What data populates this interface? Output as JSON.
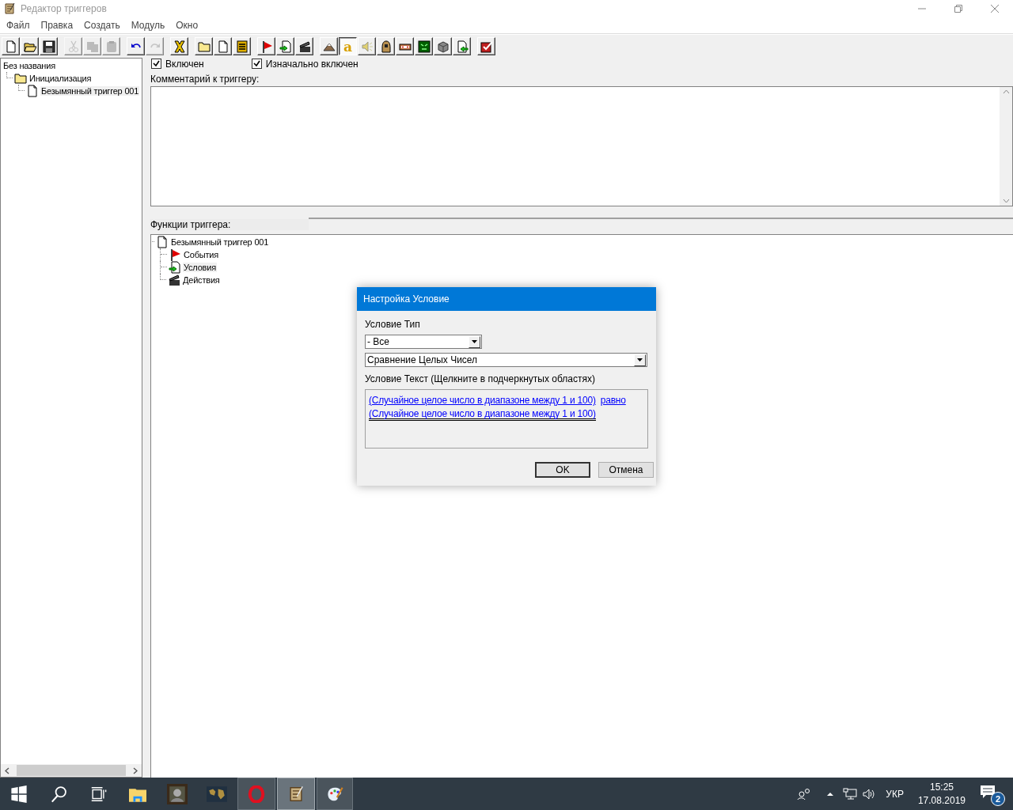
{
  "window": {
    "title": "Редактор триггеров"
  },
  "menu": [
    {
      "label": "Файл"
    },
    {
      "label": "Правка"
    },
    {
      "label": "Создать"
    },
    {
      "label": "Модуль"
    },
    {
      "label": "Окно"
    }
  ],
  "toolbar_groups": [
    {
      "buttons": [
        {
          "kind": "new",
          "disabled": false,
          "pressed": false
        },
        {
          "kind": "open",
          "disabled": false,
          "pressed": false
        },
        {
          "kind": "save",
          "disabled": false,
          "pressed": false
        }
      ]
    },
    {
      "buttons": [
        {
          "kind": "cut",
          "disabled": true,
          "pressed": false
        },
        {
          "kind": "copy",
          "disabled": true,
          "pressed": false
        },
        {
          "kind": "paste",
          "disabled": true,
          "pressed": false
        }
      ]
    },
    {
      "buttons": [
        {
          "kind": "undo",
          "disabled": false,
          "pressed": false
        },
        {
          "kind": "redo",
          "disabled": true,
          "pressed": false
        }
      ]
    },
    {
      "buttons": [
        {
          "kind": "delete",
          "disabled": false,
          "pressed": false
        }
      ]
    },
    {
      "buttons": [
        {
          "kind": "category",
          "disabled": false,
          "pressed": false
        },
        {
          "kind": "trigger",
          "disabled": false,
          "pressed": false
        },
        {
          "kind": "comment",
          "disabled": false,
          "pressed": false
        }
      ]
    },
    {
      "buttons": [
        {
          "kind": "event",
          "disabled": false,
          "pressed": false
        },
        {
          "kind": "condition",
          "disabled": false,
          "pressed": false
        },
        {
          "kind": "action",
          "disabled": false,
          "pressed": false
        }
      ]
    },
    {
      "buttons": [
        {
          "kind": "terrain",
          "disabled": false,
          "pressed": false
        },
        {
          "kind": "text",
          "glyph": "a",
          "disabled": false,
          "pressed": true
        },
        {
          "kind": "sound",
          "disabled": false,
          "pressed": false
        },
        {
          "kind": "unit",
          "disabled": false,
          "pressed": false
        },
        {
          "kind": "item",
          "disabled": false,
          "pressed": false
        },
        {
          "kind": "model",
          "disabled": false,
          "pressed": false
        },
        {
          "kind": "cube",
          "disabled": false,
          "pressed": false
        },
        {
          "kind": "import",
          "disabled": false,
          "pressed": false
        }
      ]
    },
    {
      "buttons": [
        {
          "kind": "test",
          "disabled": false,
          "pressed": false
        }
      ]
    }
  ],
  "sidebar": {
    "tree": [
      {
        "label": "Без названия",
        "selected": false,
        "children": [
          {
            "label": "Инициализация",
            "kind": "folder",
            "selected": false,
            "children": [
              {
                "label": "Безымянный триггер 001",
                "kind": "trigger",
                "selected": true
              }
            ]
          }
        ]
      }
    ]
  },
  "trigger": {
    "enabled": {
      "label": "Включен",
      "checked": true
    },
    "initially_on": {
      "label": "Изначально включен",
      "checked": true
    },
    "comment_label": "Комментарий к триггеру:",
    "functions_label": "Функции триггера:",
    "functions_tree": [
      {
        "label": "Безымянный триггер 001",
        "kind": "trigger",
        "selected": false,
        "children": [
          {
            "label": "События",
            "kind": "event",
            "selected": false
          },
          {
            "label": "Условия",
            "kind": "condition",
            "selected": true
          },
          {
            "label": "Действия",
            "kind": "action",
            "selected": false
          }
        ]
      }
    ]
  },
  "dialog": {
    "title": "Настройка Условие",
    "type_label": "Условие Тип",
    "type_value": "- Все",
    "function_value": "Сравнение Целых Чисел",
    "text_label": "Условие Текст (Щелкните в подчеркнутых областях)",
    "text_lines": [
      {
        "parts": [
          {
            "text": "(Случайное целое число в диапазоне между 1 и 100)",
            "focused": false
          },
          {
            "text": "равно",
            "focused": false
          }
        ]
      },
      {
        "parts": [
          {
            "text": "(Случайное целое число в диапазоне между 1 и 100)",
            "focused": true
          }
        ]
      }
    ],
    "buttons": [
      {
        "label": "OK",
        "default": true
      },
      {
        "label": "Отмена",
        "default": false
      }
    ]
  },
  "taskbar": {
    "apps": [
      {
        "kind": "start",
        "running": false,
        "active": false
      },
      {
        "kind": "search",
        "running": false,
        "active": false
      },
      {
        "kind": "task-view",
        "running": false,
        "active": false
      },
      {
        "kind": "explorer",
        "running": false,
        "active": false
      },
      {
        "kind": "hero",
        "running": false,
        "active": false
      },
      {
        "kind": "map",
        "running": false,
        "active": false
      },
      {
        "kind": "browser",
        "running": true,
        "active": false
      },
      {
        "kind": "editor",
        "running": true,
        "active": true
      },
      {
        "kind": "paint",
        "running": true,
        "active": false
      }
    ],
    "language": "УКР",
    "time": "15:25",
    "date": "17.08.2019",
    "notifications": "2"
  }
}
